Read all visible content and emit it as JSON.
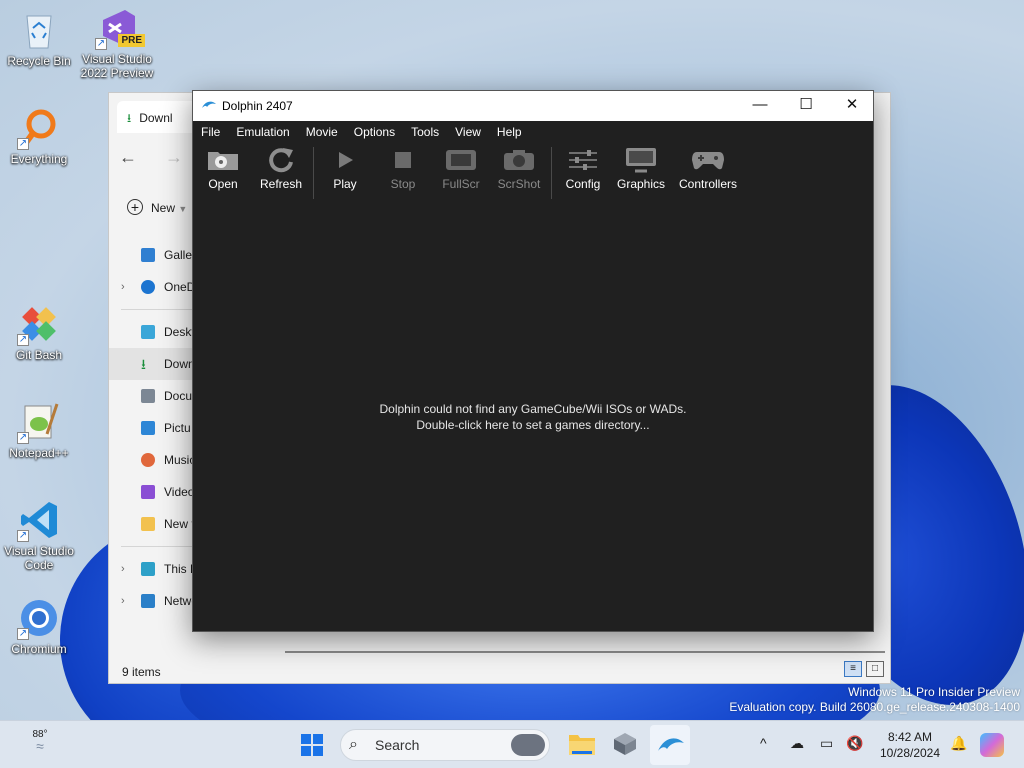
{
  "desktop": {
    "icons": [
      {
        "label": "Recycle Bin",
        "icon": "recycle-bin-icon"
      },
      {
        "label": "Visual Studio 2022 Preview",
        "icon": "visual-studio-icon",
        "badge": "PRE"
      },
      {
        "label": "Everything",
        "icon": "everything-search-icon"
      },
      {
        "label": "Git Bash",
        "icon": "git-bash-icon"
      },
      {
        "label": "Notepad++",
        "icon": "notepad-plus-plus-icon"
      },
      {
        "label": "Visual Studio Code",
        "icon": "vscode-icon"
      },
      {
        "label": "Chromium",
        "icon": "chromium-icon"
      }
    ],
    "watermark_line1": "Windows 11 Pro Insider Preview",
    "watermark_line2": "Evaluation copy. Build 26080.ge_release.240308-1400"
  },
  "explorer": {
    "tab_label": "Downl",
    "new_label": "New",
    "sidebar": [
      {
        "label": "Galler",
        "icon": "gallery-icon",
        "color": "#2f7fd1"
      },
      {
        "label": "OneD",
        "icon": "onedrive-icon",
        "color": "#1c74d0",
        "chevron": true
      },
      {
        "label": "Deskt",
        "icon": "desktop-folder-icon",
        "color": "#3aa6d8"
      },
      {
        "label": "Down",
        "icon": "downloads-folder-icon",
        "color": "#1a8e3b",
        "selected": true
      },
      {
        "label": "Docu",
        "icon": "documents-folder-icon",
        "color": "#7c8794"
      },
      {
        "label": "Pictu",
        "icon": "pictures-folder-icon",
        "color": "#2d86d6"
      },
      {
        "label": "Music",
        "icon": "music-folder-icon",
        "color": "#e0673b"
      },
      {
        "label": "Video",
        "icon": "videos-folder-icon",
        "color": "#8a4ed4"
      },
      {
        "label": "New f",
        "icon": "new-folder-icon",
        "color": "#f2c14e"
      },
      {
        "label": "This P",
        "icon": "this-pc-icon",
        "color": "#2da0c8",
        "chevron": true
      },
      {
        "label": "Network",
        "icon": "network-icon",
        "color": "#2a7fc8",
        "chevron": true
      }
    ],
    "status": "9 items"
  },
  "dolphin": {
    "title": "Dolphin 2407",
    "accent": "#2b8fd6",
    "menu": [
      "File",
      "Emulation",
      "Movie",
      "Options",
      "Tools",
      "View",
      "Help"
    ],
    "toolbar": [
      {
        "label": "Open",
        "icon": "open-folder-icon",
        "enabled": true
      },
      {
        "label": "Refresh",
        "icon": "refresh-icon",
        "enabled": true
      },
      {
        "label": "Play",
        "icon": "play-icon",
        "enabled": true
      },
      {
        "label": "Stop",
        "icon": "stop-icon",
        "enabled": false
      },
      {
        "label": "FullScr",
        "icon": "fullscreen-icon",
        "enabled": false
      },
      {
        "label": "ScrShot",
        "icon": "screenshot-icon",
        "enabled": false
      },
      {
        "label": "Config",
        "icon": "config-sliders-icon",
        "enabled": true
      },
      {
        "label": "Graphics",
        "icon": "graphics-monitor-icon",
        "enabled": true
      },
      {
        "label": "Controllers",
        "icon": "gamepad-icon",
        "enabled": true
      }
    ],
    "empty_line1": "Dolphin could not find any GameCube/Wii ISOs or WADs.",
    "empty_line2": "Double-click here to set a games directory..."
  },
  "taskbar": {
    "weather_temp": "88°",
    "search_placeholder": "Search",
    "time": "8:42 AM",
    "date": "10/28/2024",
    "apps": [
      "start-icon",
      "search-widget-icon",
      "file-explorer-icon",
      "package-icon",
      "dolphin-icon"
    ]
  }
}
